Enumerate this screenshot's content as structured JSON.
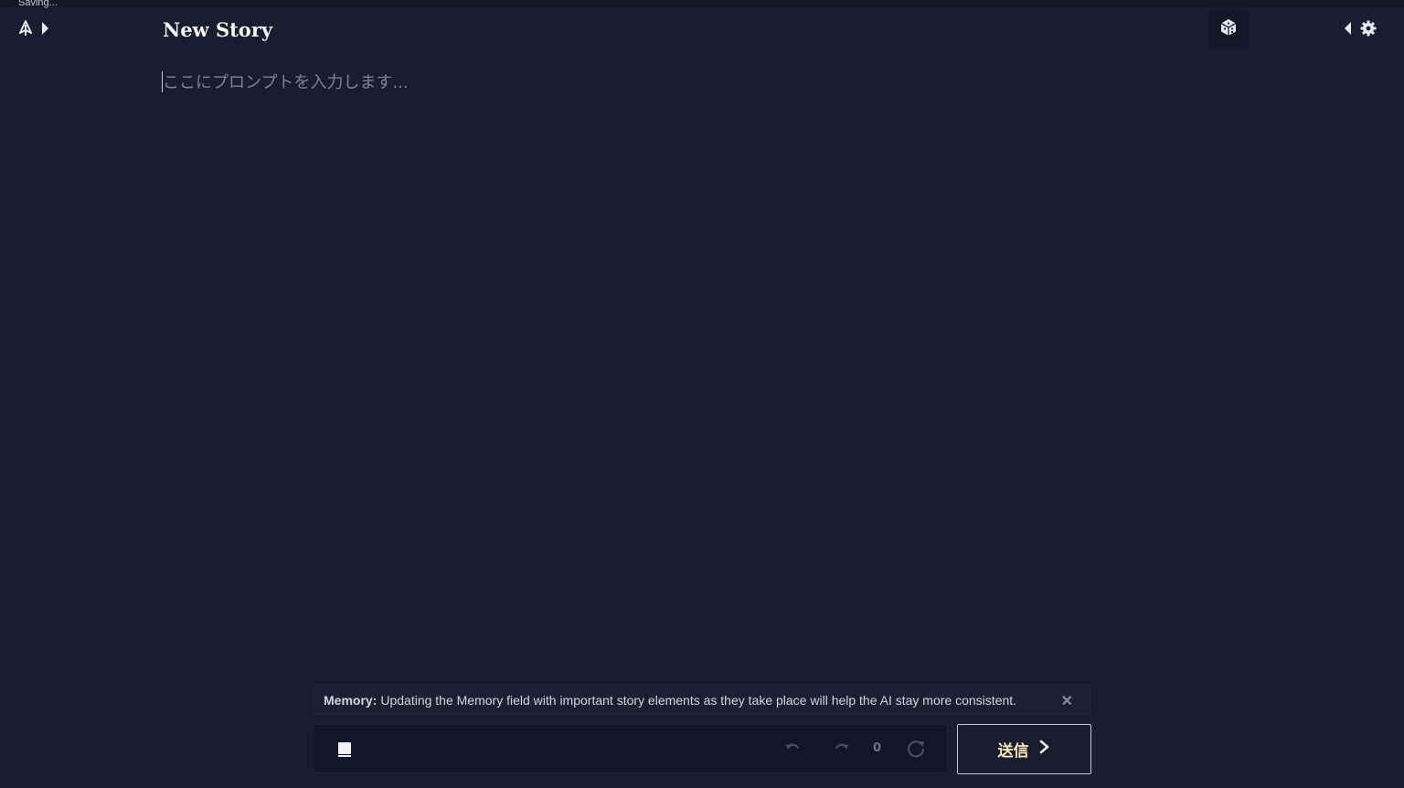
{
  "status": {
    "saving_text": "Saving..."
  },
  "header": {
    "title": "New Story"
  },
  "editor": {
    "placeholder": "ここにプロンプトを入力します..."
  },
  "memory_tip": {
    "label": "Memory:",
    "text": "Updating the Memory field with important story elements as they take place will help the AI stay more consistent.",
    "close_symbol": "✕"
  },
  "controls": {
    "counter": "0",
    "send_label": "送信"
  },
  "colors": {
    "background": "#1a1c2f",
    "input_bg": "#13152a",
    "send_text": "#f5e8b8",
    "placeholder": "#80819a"
  },
  "icons": {
    "left": [
      "novelai-logo-icon",
      "chevron-right-icon"
    ],
    "right": [
      "dice-icon",
      "chevron-left-icon",
      "gear-icon"
    ],
    "bar": [
      "book-icon",
      "undo-icon",
      "redo-icon",
      "retry-icon",
      "send-arrow-icon"
    ]
  }
}
